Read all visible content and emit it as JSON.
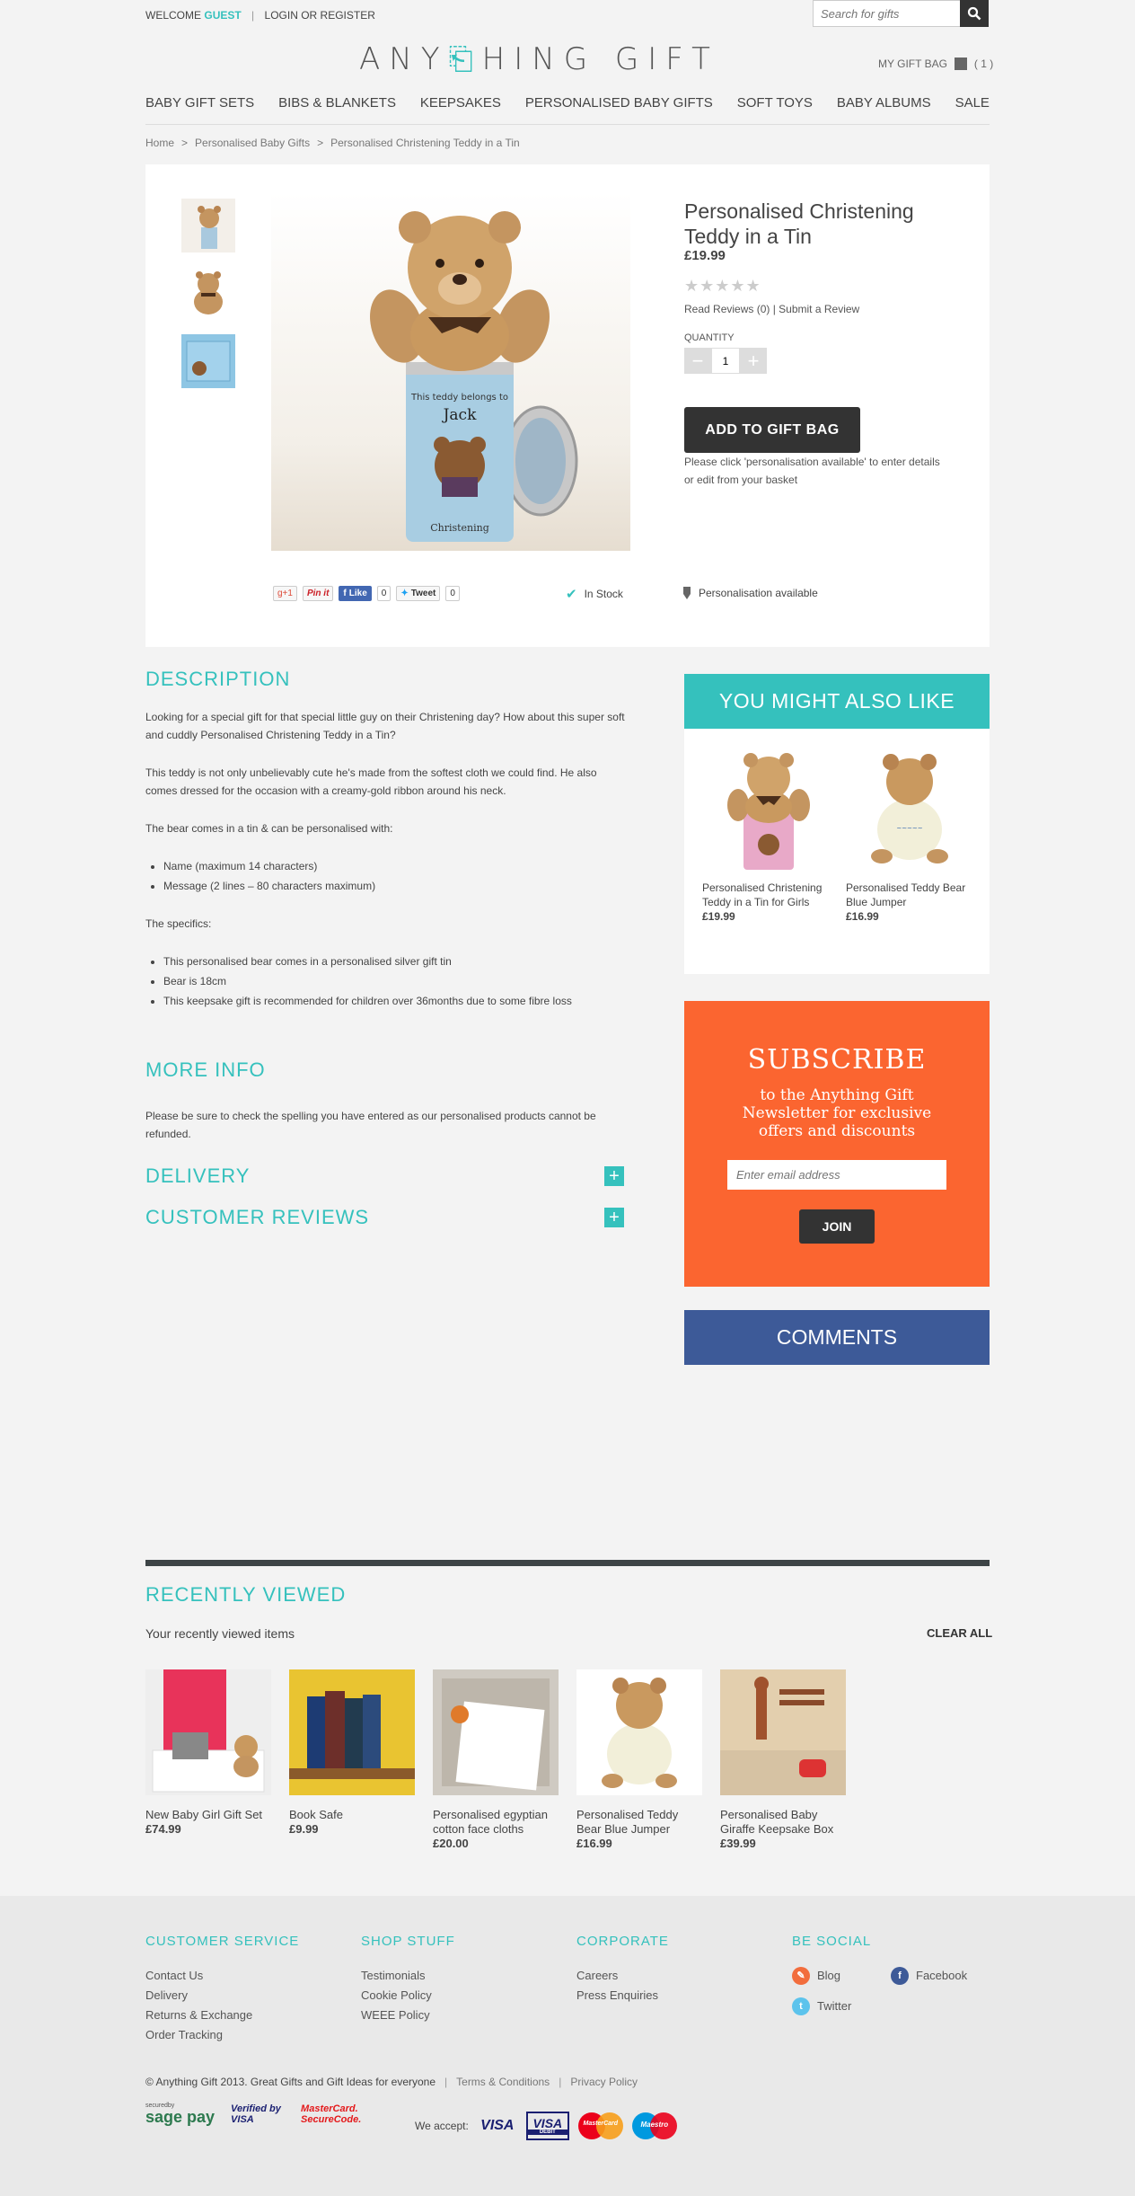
{
  "header": {
    "welcome": "WELCOME",
    "guest": "GUEST",
    "login": "LOGIN OR REGISTER",
    "search_placeholder": "Search for gifts",
    "logo_a": "ANY",
    "logo_b": "HING GIFT",
    "gift_bag": "MY GIFT BAG",
    "gift_bag_count": "( 1 )"
  },
  "nav": [
    "BABY GIFT SETS",
    "BIBS & BLANKETS",
    "KEEPSAKES",
    "PERSONALISED BABY GIFTS",
    "SOFT TOYS",
    "BABY ALBUMS",
    "SALE"
  ],
  "breadcrumb": [
    "Home",
    "Personalised Baby Gifts",
    "Personalised Christening Teddy in a Tin"
  ],
  "product": {
    "title": "Personalised Christening Teddy in a Tin",
    "price": "£19.99",
    "stars": "★★★★★",
    "rating": 0,
    "reviews_link": "Read Reviews (0)",
    "submit_review": "Submit a Review",
    "quantity_label": "QUANTITY",
    "quantity": "1",
    "add_button": "ADD TO GIFT BAG",
    "note": "Please click 'personalisation available' to enter details or edit from your basket",
    "tin_name": "Jack",
    "tin_caption": "This teddy belongs to",
    "tin_footer": "Christening",
    "in_stock": "In Stock",
    "personalisation": "Personalisation available",
    "social": {
      "gplus": "g+1",
      "pinit": "Pin it",
      "like": "Like",
      "like_count": "0",
      "tweet": "Tweet",
      "tweet_count": "0"
    }
  },
  "description": {
    "heading": "DESCRIPTION",
    "p1": "Looking for a special gift for that special little guy on their Christening day? How about this super soft and cuddly Personalised Christening Teddy in a Tin?",
    "p2": "This teddy is not only unbelievably cute he's made from the softest cloth we could find. He also comes dressed for the occasion with a creamy-gold ribbon around his neck.",
    "p3": "The bear comes in a tin & can be personalised with:",
    "list1": [
      "Name (maximum 14 characters)",
      "Message (2 lines – 80 characters maximum)"
    ],
    "p4": "The specifics:",
    "list2": [
      "This personalised bear comes in a personalised silver gift tin",
      "Bear is 18cm",
      "This keepsake gift is recommended for children over 36months due to some fibre loss"
    ]
  },
  "more_info": {
    "heading": "MORE INFO",
    "text": "Please be sure to check the spelling you have entered as our personalised products cannot be refunded."
  },
  "accordions": {
    "delivery": "DELIVERY",
    "reviews": "CUSTOMER REVIEWS"
  },
  "also_like": {
    "heading": "YOU MIGHT ALSO LIKE",
    "items": [
      {
        "name": "Personalised Christening Teddy in a Tin for Girls",
        "price": "£19.99"
      },
      {
        "name": "Personalised Teddy Bear Blue Jumper",
        "price": "£16.99"
      }
    ]
  },
  "subscribe": {
    "heading": "SUBSCRIBE",
    "text": "to the Anything Gift Newsletter for exclusive offers and discounts",
    "placeholder": "Enter email address",
    "button": "JOIN"
  },
  "comments": "COMMENTS",
  "recently_viewed": {
    "heading": "RECENTLY VIEWED",
    "sub": "Your recently viewed items",
    "clear": "CLEAR ALL",
    "items": [
      {
        "name": "New Baby Girl Gift Set",
        "price": "£74.99"
      },
      {
        "name": "Book Safe",
        "price": "£9.99"
      },
      {
        "name": "Personalised egyptian cotton face cloths",
        "price": "£20.00"
      },
      {
        "name": "Personalised Teddy Bear Blue Jumper",
        "price": "£16.99"
      },
      {
        "name": "Personalised Baby Giraffe Keepsake Box",
        "price": "£39.99"
      }
    ]
  },
  "footer": {
    "customer_service": {
      "heading": "CUSTOMER SERVICE",
      "links": [
        "Contact Us",
        "Delivery",
        "Returns & Exchange",
        "Order Tracking"
      ]
    },
    "shop_stuff": {
      "heading": "SHOP STUFF",
      "links": [
        "Testimonials",
        "Cookie Policy",
        "WEEE Policy"
      ]
    },
    "corporate": {
      "heading": "CORPORATE",
      "links": [
        "Careers",
        "Press Enquiries"
      ]
    },
    "be_social": {
      "heading": "BE SOCIAL",
      "blog": "Blog",
      "facebook": "Facebook",
      "twitter": "Twitter"
    },
    "copyright": "© Anything Gift 2013. Great Gifts and Gift Ideas for everyone",
    "terms": "Terms & Conditions",
    "privacy": "Privacy Policy",
    "we_accept": "We accept:",
    "sagepay": "sage pay",
    "sagepay_small": "securedby",
    "verified": "Verified by VISA",
    "securecode": "MasterCard. SecureCode.",
    "cards": [
      "VISA",
      "VISA",
      "MasterCard",
      "Maestro"
    ],
    "visa_debit": "DEBIT"
  },
  "colors": {
    "accent": "#35c1bd",
    "subscribe": "#fb6530",
    "comments": "#3d5a98",
    "dark": "#333333"
  }
}
